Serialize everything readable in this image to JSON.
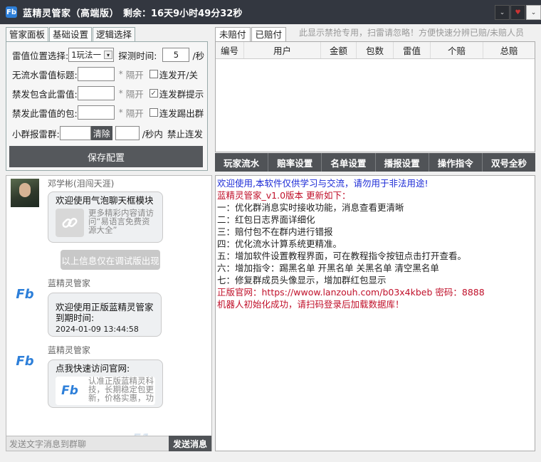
{
  "window": {
    "logo": "Fb",
    "title": "蓝精灵管家（高端版）",
    "remaining": "剩余：16天9小时49分32秒"
  },
  "window_buttons": [
    "⌄",
    "♥",
    "⌄"
  ],
  "left_tabs": [
    "管家面板",
    "基础设置",
    "逻辑选择"
  ],
  "config": {
    "position_label": "雷值位置选择:",
    "position_value": "1玩法一",
    "detect_label": "探测时间:",
    "detect_value": "5",
    "detect_unit": "/秒",
    "no_flow_label": "无流水雷值标题:",
    "interval_1": "隔开",
    "continuous_toggle": "连发开/关",
    "ban_contain_label": "禁发包含此雷值:",
    "interval_2": "隔开",
    "continuous_group_tip": "连发群提示",
    "ban_this_label": "禁发此雷值的包:",
    "interval_3": "隔开",
    "continuous_kick": "连发踢出群",
    "small_group_label": "小群报雷群:",
    "clear_label": "清除",
    "per_second_label": "/秒内",
    "ban_continuous": "禁止连发",
    "save_label": "保存配置",
    "star": "*",
    "check_mark": "✓"
  },
  "chat": {
    "msg1": {
      "sender": "邓学彬(泪闯天涯)",
      "title": "欢迎使用气泡聊天框模块",
      "desc": "更多精彩内容请访问“易语言免费资源大全”",
      "icon": "link-icon"
    },
    "notice": "以上信息仅在调试版出现",
    "msg2": {
      "sender": "蓝精灵管家",
      "line1": "欢迎使用正版蓝精灵管家到期时间:",
      "line2": "2024-01-09 13:44:58"
    },
    "msg3": {
      "sender": "蓝精灵管家",
      "title": "点我快速访问官网:",
      "desc": "认准正版蓝精灵科技，长期稳定包更新，价格实惠，功"
    },
    "input_placeholder": "发送文字消息到群聊",
    "send_label": "发送消息"
  },
  "right_tabs": [
    "未赔付",
    "已赔付"
  ],
  "hint": "此显示禁抢专用，扫雷请忽略！方便快速分辨已赔/未赔人员",
  "table": {
    "columns": [
      "编号",
      "用户",
      "金额",
      "包数",
      "雷值",
      "个赔",
      "总赔"
    ]
  },
  "actions": [
    "玩家流水",
    "赔率设置",
    "名单设置",
    "播报设置",
    "操作指令",
    "双号全秒"
  ],
  "log": [
    {
      "text": "欢迎使用,本软件仅供学习与交流，请勿用于非法用途!",
      "color": "blue"
    },
    {
      "text": "蓝精灵管家_v1.0版本 更新如下：",
      "color": "red"
    },
    {
      "text": "一：优化群消息实时接收功能，消息查看更清晰",
      "color": "dark"
    },
    {
      "text": "二：红包日志界面详细化",
      "color": "dark"
    },
    {
      "text": "三：赔付包不在群内进行错报",
      "color": "dark"
    },
    {
      "text": "四：优化流水计算系统更精准。",
      "color": "dark"
    },
    {
      "text": "五：增加软件设置教程界面，可在教程指令按钮点击打开查看。",
      "color": "dark"
    },
    {
      "text": "六：增加指令：踢黑名单 开黑名单 关黑名单 清空黑名单",
      "color": "dark"
    },
    {
      "text": "七：修复群成员头像显示，增加群红包显示",
      "color": "dark"
    },
    {
      "text": "正版官网：https://wwow.lanzouh.com/b03x4kbeb 密码：8888",
      "color": "red"
    },
    {
      "text": "机器人初始化成功，请扫码登录后加载数据库！",
      "color": "red"
    }
  ],
  "watermark": "51",
  "colors": {
    "title_bar": "#333740",
    "button_dark": "#505357",
    "log_blue": "#1a29d6",
    "log_red": "#c0102a"
  }
}
